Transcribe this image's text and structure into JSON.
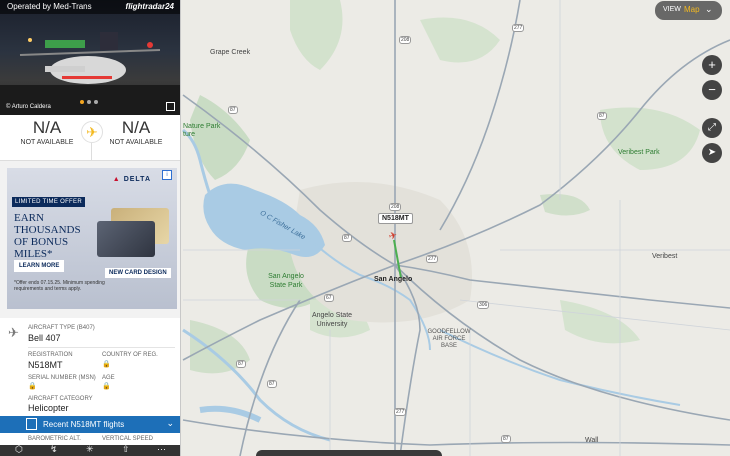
{
  "sidebar": {
    "operated_by": "Operated by Med-Trans",
    "logo": "flightradar24",
    "photo_credit": "© Arturo Caldera",
    "origin": {
      "code": "N/A",
      "status": "NOT AVAILABLE"
    },
    "destination": {
      "code": "N/A",
      "status": "NOT AVAILABLE"
    },
    "ad": {
      "brand": "DELTA",
      "tag": "LIMITED TIME OFFER",
      "headline": "EARN THOUSANDS OF BONUS MILES*",
      "cta": "LEARN MORE",
      "card_badge": "NEW CARD DESIGN",
      "fine_print": "*Offer ends 07.15.25. Minimum spending requirements and terms apply."
    },
    "details": {
      "aircraft_type_label": "AIRCRAFT TYPE (B407)",
      "aircraft_type": "Bell 407",
      "registration_label": "REGISTRATION",
      "registration": "N518MT",
      "country_label": "COUNTRY OF REG.",
      "serial_label": "SERIAL NUMBER (MSN)",
      "age_label": "AGE",
      "category_label": "AIRCRAFT CATEGORY",
      "category": "Helicopter"
    },
    "recent_flights": "Recent N518MT flights",
    "baro_label": "BAROMETRIC ALT.",
    "vspeed_label": "VERTICAL SPEED"
  },
  "map": {
    "view_label": "VIEW",
    "view_mode": "Map",
    "callsign": "N518MT",
    "labels": {
      "grape_creek": "Grape Creek",
      "nature_park": "Nature Park",
      "ture": "ture",
      "veribest_park": "Veribest Park",
      "oc_fisher": "O C Fisher Lake",
      "san_angelo": "San Angelo",
      "san_angelo_sp": "San Angelo State Park",
      "angelo_state": "Angelo State University",
      "goodfellow": "GOODFELLOW AIR FORCE BASE",
      "veribest": "Veribest",
      "wall": "Wall"
    },
    "shields": {
      "s208n": "208",
      "s277ne": "277",
      "s87n": "87",
      "s87ne": "87",
      "s208": "208",
      "s87w": "87",
      "s277": "277",
      "s67": "67",
      "s306": "306",
      "s87sw": "87",
      "s87s": "87",
      "s277s": "277",
      "s87se": "87"
    }
  }
}
